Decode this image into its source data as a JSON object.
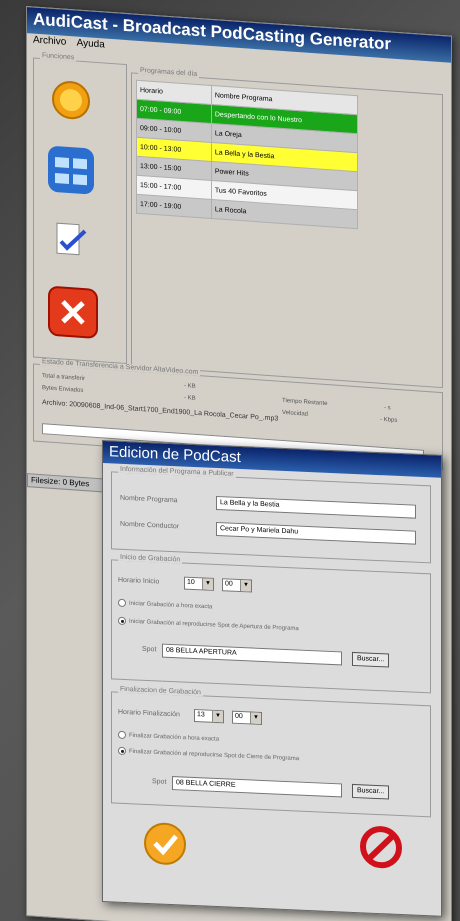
{
  "window": {
    "title": "AudiCast - Broadcast PodCasting Generator"
  },
  "menu": [
    {
      "label": "Archivo"
    },
    {
      "label": "Ayuda"
    }
  ],
  "groups": {
    "funciones": "Funciones",
    "programas": "Programas del día",
    "estado": "Estado de Transferencia a Servidor AltaVideo.com"
  },
  "table": {
    "headers": [
      "Horario",
      "Nombre Programa"
    ],
    "rows": [
      {
        "time": "07:00 - 09:00",
        "name": "Despertando con lo Nuestro",
        "color": "#19a619"
      },
      {
        "time": "09:00 - 10:00",
        "name": "La Oreja",
        "color": "#c8c8c8"
      },
      {
        "time": "10:00 - 13:00",
        "name": "La Bella y la Bestia",
        "color": "#ffff33"
      },
      {
        "time": "13:00 - 15:00",
        "name": "Power Hits",
        "color": "#c8c8c8"
      },
      {
        "time": "15:00 - 17:00",
        "name": "Tus 40 Favoritos",
        "color": "#f4f4f4"
      },
      {
        "time": "17:00 - 19:00",
        "name": "La Rocola",
        "color": "#c8c8c8"
      }
    ]
  },
  "transfer": {
    "total_label": "Total a transferir",
    "total_value": "- KB",
    "bytes_label": "Bytes Enviados",
    "bytes_value": "- KB",
    "tiempo_label": "Tiempo Restante",
    "tiempo_value": "- s",
    "vel_label": "Velocidad",
    "vel_value": "- Kbps",
    "archivo": "Archivo: 20090608_Ind-06_Start1700_End1900_La Rocola_Cecar Po_.mp3"
  },
  "status_bar": "Filesize: 0 Bytes",
  "dialog": {
    "title": "Edicion de PodCast",
    "info_group": "Información del Programa a Publicar",
    "programa_label": "Nombre Programa",
    "programa_value": "La Bella y la Bestia",
    "conductor_label": "Nombre Conductor",
    "conductor_value": "Cecar Po y Mariela Dahu",
    "inicio_group": "Inicio de Grabación",
    "inicio_label": "Horario Inicio",
    "inicio_hour": "10",
    "inicio_min": "00",
    "inicio_radio1": "Iniciar Grabación a hora exacta",
    "inicio_radio2": "Iniciar Grabación al reproducirse Spot de Apertura de Programa",
    "spot_label": "Spot",
    "spot_inicio": "08 BELLA APERTURA",
    "buscar": "Buscar...",
    "fin_group": "Finalizacion de Grabación",
    "fin_label": "Horario Finalización",
    "fin_hour": "13",
    "fin_min": "00",
    "fin_radio1": "Finalizar Grabación a hora exacta",
    "fin_radio2": "Finalizar Grabación al reproducirse Spot de Cierre de Programa",
    "spot_fin": "08 BELLA CIERRE"
  }
}
